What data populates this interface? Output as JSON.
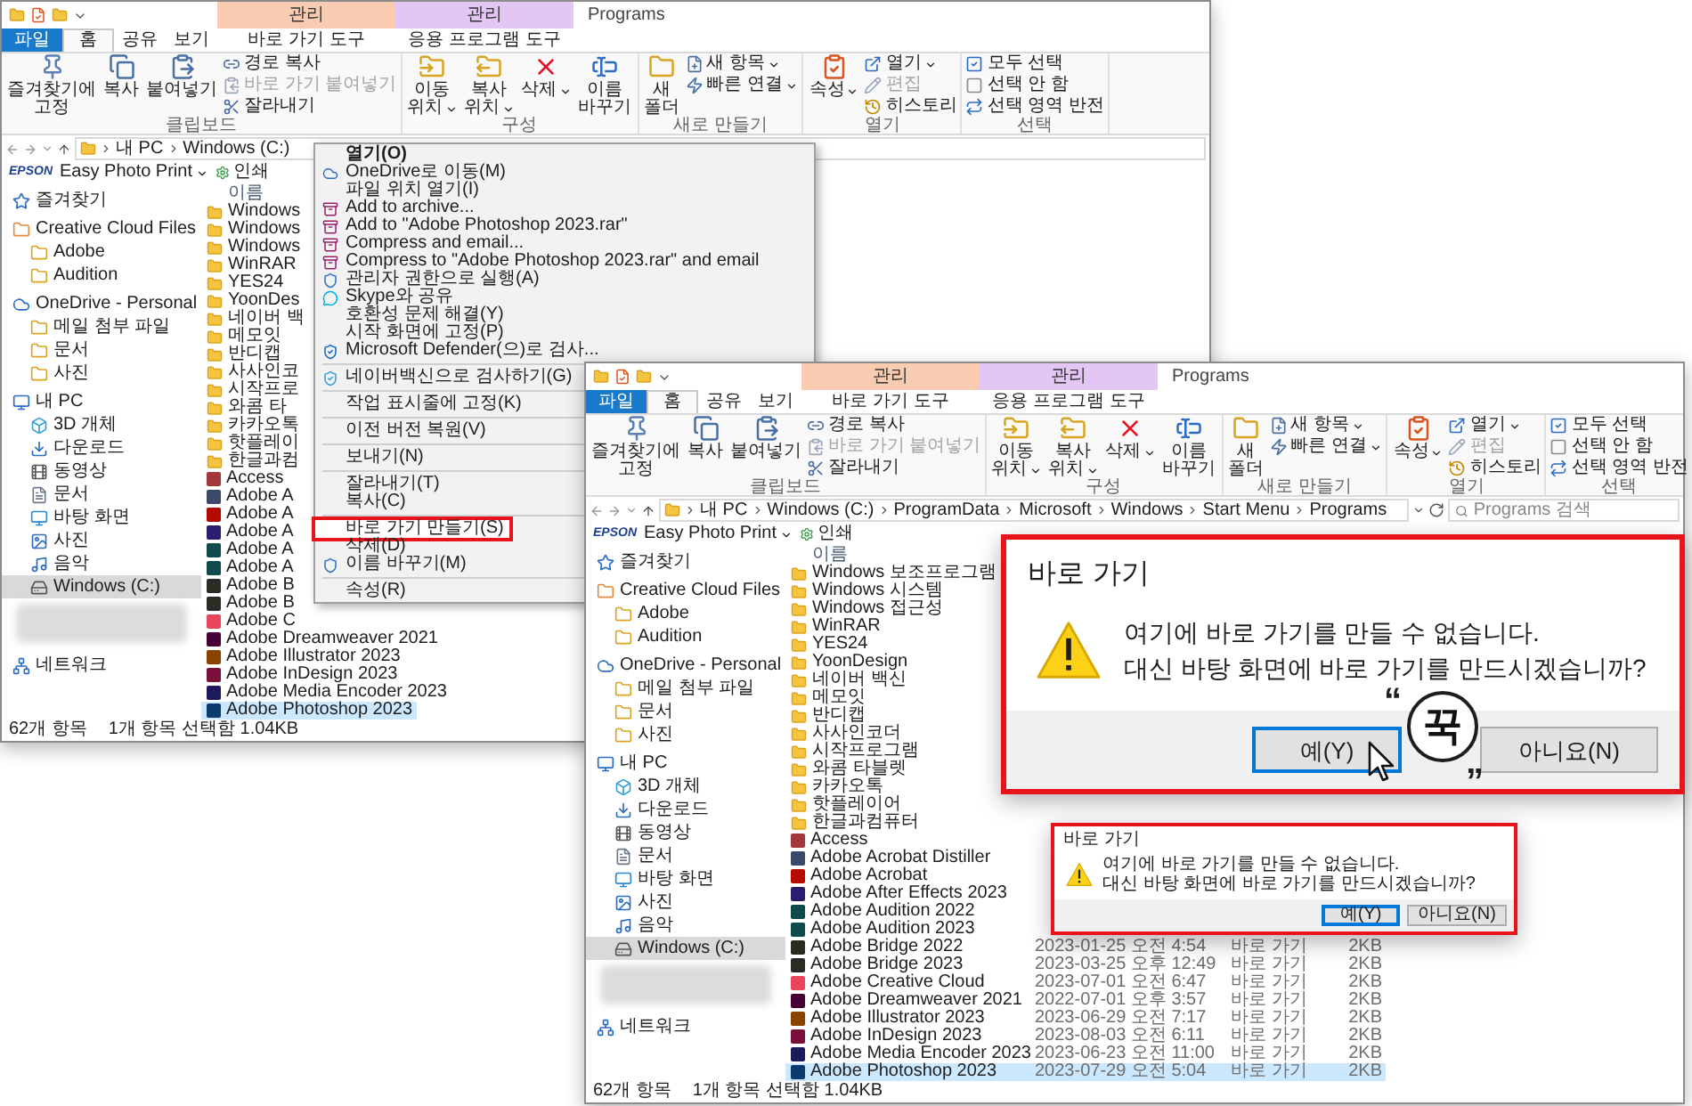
{
  "window_back": {
    "context_headers": [
      {
        "label": "관리",
        "color": "#f9cbb0"
      },
      {
        "label": "관리",
        "color": "#e3c6f4"
      }
    ],
    "title": "Programs",
    "tabs": [
      {
        "label": "파일",
        "kind": "file",
        "selected": false
      },
      {
        "label": "홈",
        "kind": "plain",
        "selected": true
      },
      {
        "label": "공유",
        "kind": "plain",
        "selected": false
      },
      {
        "label": "보기",
        "kind": "plain",
        "selected": false
      },
      {
        "label": "바로 가기 도구",
        "kind": "context",
        "selected": false
      },
      {
        "label": "응용 프로그램 도구",
        "kind": "context",
        "selected": false
      }
    ],
    "ribbon": [
      {
        "label": "클립보드",
        "items": [
          {
            "kind": "large",
            "lines": [
              "즐겨찾기에",
              "고정"
            ],
            "dropdown": false
          },
          {
            "kind": "large",
            "lines": [
              "복사"
            ],
            "dropdown": false
          },
          {
            "kind": "large",
            "lines": [
              "붙여넣기"
            ],
            "dropdown": false
          },
          {
            "kind": "stack",
            "items": [
              {
                "label": "경로 복사",
                "disabled": false,
                "dropdown": false
              },
              {
                "label": "바로 가기 붙여넣기",
                "disabled": true,
                "dropdown": false
              },
              {
                "label": "잘라내기",
                "disabled": false,
                "dropdown": false
              }
            ]
          }
        ]
      },
      {
        "label": "구성",
        "items": [
          {
            "kind": "large",
            "lines": [
              "이동",
              "위치"
            ],
            "dropdown": true
          },
          {
            "kind": "large",
            "lines": [
              "복사",
              "위치"
            ],
            "dropdown": true
          },
          {
            "kind": "large",
            "lines": [
              "삭제"
            ],
            "dropdown": true
          },
          {
            "kind": "large",
            "lines": [
              "이름",
              "바꾸기"
            ],
            "dropdown": false
          }
        ]
      },
      {
        "label": "새로 만들기",
        "items": [
          {
            "kind": "large",
            "lines": [
              "새",
              "폴더"
            ],
            "dropdown": false
          },
          {
            "kind": "stack",
            "items": [
              {
                "label": "새 항목",
                "disabled": false,
                "dropdown": true
              },
              {
                "label": "빠른 연결",
                "disabled": false,
                "dropdown": true
              }
            ]
          }
        ]
      },
      {
        "label": "열기",
        "items": [
          {
            "kind": "large",
            "lines": [
              "속성"
            ],
            "dropdown": true
          },
          {
            "kind": "stack",
            "items": [
              {
                "label": "열기",
                "disabled": false,
                "dropdown": true
              },
              {
                "label": "편집",
                "disabled": true,
                "dropdown": false
              },
              {
                "label": "히스토리",
                "disabled": false,
                "dropdown": false
              }
            ]
          }
        ]
      },
      {
        "label": "선택",
        "items": [
          {
            "kind": "stack",
            "items": [
              {
                "label": "모두 선택",
                "disabled": false,
                "dropdown": false
              },
              {
                "label": "선택 안 함",
                "disabled": false,
                "dropdown": false
              },
              {
                "label": "선택 영역 반전",
                "disabled": false,
                "dropdown": false
              }
            ]
          }
        ]
      }
    ],
    "address": {
      "crumbs": [
        "내 PC",
        "Windows (C:)"
      ]
    },
    "bookmarks": {
      "brand": "EPSON",
      "items": [
        {
          "label": "Easy Photo Print",
          "kind": "dropdown"
        },
        {
          "label": "인쇄",
          "kind": "action"
        }
      ]
    },
    "nav": [
      {
        "label": "즐겨찾기",
        "kind": "item",
        "selected": false
      },
      {
        "label": "Creative Cloud Files",
        "kind": "item",
        "selected": false,
        "children": [
          {
            "label": "Adobe",
            "kind": "item",
            "selected": false
          },
          {
            "label": "Audition",
            "kind": "item",
            "selected": false
          }
        ]
      },
      {
        "label": "OneDrive - Personal",
        "kind": "item",
        "selected": false,
        "children": [
          {
            "label": "메일 첨부 파일",
            "kind": "item",
            "selected": false
          },
          {
            "label": "문서",
            "kind": "item",
            "selected": false
          },
          {
            "label": "사진",
            "kind": "item",
            "selected": false
          }
        ]
      },
      {
        "label": "내 PC",
        "kind": "item",
        "selected": false,
        "children": [
          {
            "label": "3D 개체",
            "kind": "item",
            "selected": false
          },
          {
            "label": "다운로드",
            "kind": "item",
            "selected": false
          },
          {
            "label": "동영상",
            "kind": "item",
            "selected": false
          },
          {
            "label": "문서",
            "kind": "item",
            "selected": false
          },
          {
            "label": "바탕 화면",
            "kind": "item",
            "selected": false
          },
          {
            "label": "사진",
            "kind": "item",
            "selected": false
          },
          {
            "label": "음악",
            "kind": "item",
            "selected": false
          },
          {
            "label": "Windows (C:)",
            "kind": "item",
            "selected": true
          }
        ]
      },
      {
        "kind": "redacted"
      },
      {
        "label": "네트워크",
        "kind": "item",
        "selected": false
      }
    ],
    "columns": [
      "이름"
    ],
    "rows": [
      {
        "name": "Windows",
        "kind": "folder",
        "selected": false
      },
      {
        "name": "Windows",
        "kind": "folder",
        "selected": false
      },
      {
        "name": "Windows",
        "kind": "folder",
        "selected": false
      },
      {
        "name": "WinRAR",
        "kind": "folder",
        "selected": false
      },
      {
        "name": "YES24",
        "kind": "folder",
        "selected": false
      },
      {
        "name": "YoonDes",
        "kind": "folder",
        "selected": false
      },
      {
        "name": "네이버 백",
        "kind": "folder",
        "selected": false
      },
      {
        "name": "메모잇",
        "kind": "folder",
        "selected": false
      },
      {
        "name": "반디캡",
        "kind": "folder",
        "selected": false
      },
      {
        "name": "사사인코",
        "kind": "folder",
        "selected": false
      },
      {
        "name": "시작프로",
        "kind": "folder",
        "selected": false
      },
      {
        "name": "와콤 타",
        "kind": "folder",
        "selected": false
      },
      {
        "name": "카카오톡",
        "kind": "folder",
        "selected": false
      },
      {
        "name": "핫플레이",
        "kind": "folder",
        "selected": false
      },
      {
        "name": "한글과컴",
        "kind": "folder",
        "selected": false
      },
      {
        "name": "Access",
        "kind": "app",
        "color": "#a4373a",
        "selected": false
      },
      {
        "name": "Adobe A",
        "kind": "app",
        "color": "#3b4a6b",
        "selected": false
      },
      {
        "name": "Adobe A",
        "kind": "app",
        "color": "#b30b00",
        "selected": false
      },
      {
        "name": "Adobe A",
        "kind": "app",
        "color": "#2c1c6d",
        "selected": false
      },
      {
        "name": "Adobe A",
        "kind": "app",
        "color": "#0f4a4c",
        "selected": false
      },
      {
        "name": "Adobe A",
        "kind": "app",
        "color": "#0f4a4c",
        "selected": false
      },
      {
        "name": "Adobe B",
        "kind": "app",
        "color": "#2c2a24",
        "selected": false
      },
      {
        "name": "Adobe B",
        "kind": "app",
        "color": "#2c2a24",
        "selected": false
      },
      {
        "name": "Adobe C",
        "kind": "app",
        "color": "#e8465b",
        "selected": false
      },
      {
        "name": "Adobe Dreamweaver 2021",
        "kind": "app",
        "color": "#470137",
        "selected": false
      },
      {
        "name": "Adobe Illustrator 2023",
        "kind": "app",
        "color": "#8a4200",
        "selected": false
      },
      {
        "name": "Adobe InDesign 2023",
        "kind": "app",
        "color": "#7a0f3a",
        "selected": false
      },
      {
        "name": "Adobe Media Encoder 2023",
        "kind": "app",
        "color": "#1f1a5c",
        "selected": false
      },
      {
        "name": "Adobe Photoshop 2023",
        "kind": "app",
        "color": "#0b3a6e",
        "selected": true
      }
    ],
    "status": [
      "62개 항목",
      "1개 항목 선택함 1.04KB"
    ]
  },
  "context_menu": {
    "items": [
      {
        "kind": "item",
        "label": "열기(O)",
        "bold": true,
        "highlighted": false
      },
      {
        "kind": "item",
        "label": "OneDrive로 이동(M)",
        "bold": false,
        "highlighted": false
      },
      {
        "kind": "item",
        "label": "파일 위치 열기(I)",
        "bold": false,
        "highlighted": false
      },
      {
        "kind": "item",
        "label": "Add to archive...",
        "bold": false,
        "highlighted": false
      },
      {
        "kind": "item",
        "label": "Add to \"Adobe Photoshop 2023.rar\"",
        "bold": false,
        "highlighted": false
      },
      {
        "kind": "item",
        "label": "Compress and email...",
        "bold": false,
        "highlighted": false
      },
      {
        "kind": "item",
        "label": "Compress to \"Adobe Photoshop 2023.rar\" and email",
        "bold": false,
        "highlighted": false
      },
      {
        "kind": "item",
        "label": "관리자 권한으로 실행(A)",
        "bold": false,
        "highlighted": false
      },
      {
        "kind": "item",
        "label": "Skype와 공유",
        "bold": false,
        "highlighted": false
      },
      {
        "kind": "item",
        "label": "호환성 문제 해결(Y)",
        "bold": false,
        "highlighted": false
      },
      {
        "kind": "item",
        "label": "시작 화면에 고정(P)",
        "bold": false,
        "highlighted": false
      },
      {
        "kind": "item",
        "label": "Microsoft Defender(으)로 검사...",
        "bold": false,
        "highlighted": false
      },
      {
        "kind": "separator"
      },
      {
        "kind": "item",
        "label": "네이버백신으로 검사하기(G)",
        "bold": false,
        "highlighted": false
      },
      {
        "kind": "separator"
      },
      {
        "kind": "item",
        "label": "작업 표시줄에 고정(K)",
        "bold": false,
        "highlighted": false
      },
      {
        "kind": "separator"
      },
      {
        "kind": "item",
        "label": "이전 버전 복원(V)",
        "bold": false,
        "highlighted": false
      },
      {
        "kind": "separator"
      },
      {
        "kind": "item",
        "label": "보내기(N)",
        "bold": false,
        "highlighted": false
      },
      {
        "kind": "separator"
      },
      {
        "kind": "item",
        "label": "잘라내기(T)",
        "bold": false,
        "highlighted": false
      },
      {
        "kind": "item",
        "label": "복사(C)",
        "bold": false,
        "highlighted": false
      },
      {
        "kind": "separator"
      },
      {
        "kind": "item",
        "label": "바로 가기 만들기(S)",
        "bold": false,
        "highlighted": true
      },
      {
        "kind": "item",
        "label": "삭제(D)",
        "bold": false,
        "highlighted": false
      },
      {
        "kind": "item",
        "label": "이름 바꾸기(M)",
        "bold": false,
        "highlighted": false
      },
      {
        "kind": "separator"
      },
      {
        "kind": "item",
        "label": "속성(R)",
        "bold": false,
        "highlighted": false
      }
    ]
  },
  "window_front": {
    "context_headers": [
      {
        "label": "관리",
        "color": "#f9cbb0"
      },
      {
        "label": "관리",
        "color": "#e3c6f4"
      }
    ],
    "title": "Programs",
    "tabs": [
      {
        "label": "파일",
        "kind": "file",
        "selected": false
      },
      {
        "label": "홈",
        "kind": "plain",
        "selected": true
      },
      {
        "label": "공유",
        "kind": "plain",
        "selected": false
      },
      {
        "label": "보기",
        "kind": "plain",
        "selected": false
      },
      {
        "label": "바로 가기 도구",
        "kind": "context",
        "selected": false
      },
      {
        "label": "응용 프로그램 도구",
        "kind": "context",
        "selected": false
      }
    ],
    "ribbon": [
      {
        "label": "클립보드",
        "items": [
          {
            "kind": "large",
            "lines": [
              "즐겨찾기에",
              "고정"
            ],
            "dropdown": false
          },
          {
            "kind": "large",
            "lines": [
              "복사"
            ],
            "dropdown": false
          },
          {
            "kind": "large",
            "lines": [
              "붙여넣기"
            ],
            "dropdown": false
          },
          {
            "kind": "stack",
            "items": [
              {
                "label": "경로 복사",
                "disabled": false,
                "dropdown": false
              },
              {
                "label": "바로 가기 붙여넣기",
                "disabled": true,
                "dropdown": false
              },
              {
                "label": "잘라내기",
                "disabled": false,
                "dropdown": false
              }
            ]
          }
        ]
      },
      {
        "label": "구성",
        "items": [
          {
            "kind": "large",
            "lines": [
              "이동",
              "위치"
            ],
            "dropdown": true
          },
          {
            "kind": "large",
            "lines": [
              "복사",
              "위치"
            ],
            "dropdown": true
          },
          {
            "kind": "large",
            "lines": [
              "삭제"
            ],
            "dropdown": true
          },
          {
            "kind": "large",
            "lines": [
              "이름",
              "바꾸기"
            ],
            "dropdown": false
          }
        ]
      },
      {
        "label": "새로 만들기",
        "items": [
          {
            "kind": "large",
            "lines": [
              "새",
              "폴더"
            ],
            "dropdown": false
          },
          {
            "kind": "stack",
            "items": [
              {
                "label": "새 항목",
                "disabled": false,
                "dropdown": true
              },
              {
                "label": "빠른 연결",
                "disabled": false,
                "dropdown": true
              }
            ]
          }
        ]
      },
      {
        "label": "열기",
        "items": [
          {
            "kind": "large",
            "lines": [
              "속성"
            ],
            "dropdown": true
          },
          {
            "kind": "stack",
            "items": [
              {
                "label": "열기",
                "disabled": false,
                "dropdown": true
              },
              {
                "label": "편집",
                "disabled": true,
                "dropdown": false
              },
              {
                "label": "히스토리",
                "disabled": false,
                "dropdown": false
              }
            ]
          }
        ]
      },
      {
        "label": "선택",
        "items": [
          {
            "kind": "stack",
            "items": [
              {
                "label": "모두 선택",
                "disabled": false,
                "dropdown": false
              },
              {
                "label": "선택 안 함",
                "disabled": false,
                "dropdown": false
              },
              {
                "label": "선택 영역 반전",
                "disabled": false,
                "dropdown": false
              }
            ]
          }
        ]
      }
    ],
    "address": {
      "crumbs": [
        "내 PC",
        "Windows (C:)",
        "ProgramData",
        "Microsoft",
        "Windows",
        "Start Menu",
        "Programs"
      ],
      "placeholder": "Programs 검색"
    },
    "bookmarks": {
      "brand": "EPSON",
      "items": [
        {
          "label": "Easy Photo Print",
          "kind": "dropdown"
        },
        {
          "label": "인쇄",
          "kind": "action"
        }
      ]
    },
    "nav": [
      {
        "label": "즐겨찾기",
        "kind": "item",
        "selected": false
      },
      {
        "label": "Creative Cloud Files",
        "kind": "item",
        "selected": false,
        "children": [
          {
            "label": "Adobe",
            "kind": "item",
            "selected": false
          },
          {
            "label": "Audition",
            "kind": "item",
            "selected": false
          }
        ]
      },
      {
        "label": "OneDrive - Personal",
        "kind": "item",
        "selected": false,
        "children": [
          {
            "label": "메일 첨부 파일",
            "kind": "item",
            "selected": false
          },
          {
            "label": "문서",
            "kind": "item",
            "selected": false
          },
          {
            "label": "사진",
            "kind": "item",
            "selected": false
          }
        ]
      },
      {
        "label": "내 PC",
        "kind": "item",
        "selected": false,
        "children": [
          {
            "label": "3D 개체",
            "kind": "item",
            "selected": false
          },
          {
            "label": "다운로드",
            "kind": "item",
            "selected": false
          },
          {
            "label": "동영상",
            "kind": "item",
            "selected": false
          },
          {
            "label": "문서",
            "kind": "item",
            "selected": false
          },
          {
            "label": "바탕 화면",
            "kind": "item",
            "selected": false
          },
          {
            "label": "사진",
            "kind": "item",
            "selected": false
          },
          {
            "label": "음악",
            "kind": "item",
            "selected": false
          },
          {
            "label": "Windows (C:)",
            "kind": "item",
            "selected": true
          }
        ]
      },
      {
        "kind": "redacted"
      },
      {
        "label": "네트워크",
        "kind": "item",
        "selected": false
      }
    ],
    "columns": [
      "이름"
    ],
    "rows": [
      {
        "name": "Windows 보조프로그램",
        "kind": "folder",
        "selected": false
      },
      {
        "name": "Windows 시스템",
        "kind": "folder",
        "selected": false
      },
      {
        "name": "Windows 접근성",
        "kind": "folder",
        "selected": false
      },
      {
        "name": "WinRAR",
        "kind": "folder",
        "selected": false
      },
      {
        "name": "YES24",
        "kind": "folder",
        "selected": false
      },
      {
        "name": "YoonDesign",
        "kind": "folder",
        "selected": false
      },
      {
        "name": "네이버 백신",
        "kind": "folder",
        "selected": false
      },
      {
        "name": "메모잇",
        "kind": "folder",
        "selected": false
      },
      {
        "name": "반디캡",
        "kind": "folder",
        "selected": false
      },
      {
        "name": "사사인코더",
        "kind": "folder",
        "selected": false
      },
      {
        "name": "시작프로그램",
        "kind": "folder",
        "selected": false
      },
      {
        "name": "와콤 타블렛",
        "kind": "folder",
        "selected": false
      },
      {
        "name": "카카오톡",
        "kind": "folder",
        "selected": false
      },
      {
        "name": "핫플레이어",
        "kind": "folder",
        "selected": false
      },
      {
        "name": "한글과컴퓨터",
        "kind": "folder",
        "selected": false
      },
      {
        "name": "Access",
        "kind": "app",
        "color": "#a4373a",
        "selected": false
      },
      {
        "name": "Adobe Acrobat Distiller",
        "kind": "app",
        "color": "#3b4a6b",
        "selected": false
      },
      {
        "name": "Adobe Acrobat",
        "kind": "app",
        "color": "#b30b00",
        "selected": false
      },
      {
        "name": "Adobe After Effects 2023",
        "kind": "app",
        "color": "#2c1c6d",
        "selected": false
      },
      {
        "name": "Adobe Audition 2022",
        "kind": "app",
        "color": "#0f4a4c",
        "selected": false
      },
      {
        "name": "Adobe Audition 2023",
        "kind": "app",
        "color": "#0f4a4c",
        "selected": false
      },
      {
        "name": "Adobe Bridge 2022",
        "kind": "app",
        "color": "#2c2a24",
        "selected": false,
        "date": "2023-01-25 오전 4:54",
        "type": "바로 가기",
        "size": "2KB"
      },
      {
        "name": "Adobe Bridge 2023",
        "kind": "app",
        "color": "#2c2a24",
        "selected": false,
        "date": "2023-03-25 오후 12:49",
        "type": "바로 가기",
        "size": "2KB"
      },
      {
        "name": "Adobe Creative Cloud",
        "kind": "app",
        "color": "#e8465b",
        "selected": false,
        "date": "2023-07-01 오전 6:47",
        "type": "바로 가기",
        "size": "2KB"
      },
      {
        "name": "Adobe Dreamweaver 2021",
        "kind": "app",
        "color": "#470137",
        "selected": false,
        "date": "2022-07-01 오후 3:57",
        "type": "바로 가기",
        "size": "2KB"
      },
      {
        "name": "Adobe Illustrator 2023",
        "kind": "app",
        "color": "#8a4200",
        "selected": false,
        "date": "2023-06-29 오전 7:17",
        "type": "바로 가기",
        "size": "2KB"
      },
      {
        "name": "Adobe InDesign 2023",
        "kind": "app",
        "color": "#7a0f3a",
        "selected": false,
        "date": "2023-08-03 오전 6:11",
        "type": "바로 가기",
        "size": "2KB"
      },
      {
        "name": "Adobe Media Encoder 2023",
        "kind": "app",
        "color": "#1f1a5c",
        "selected": false,
        "date": "2023-06-23 오전 11:00",
        "type": "바로 가기",
        "size": "2KB"
      },
      {
        "name": "Adobe Photoshop 2023",
        "kind": "app",
        "color": "#0b3a6e",
        "selected": true,
        "date": "2023-07-29 오전 5:04",
        "type": "바로 가기",
        "size": "2KB"
      }
    ],
    "status": [
      "62개 항목",
      "1개 항목 선택함 1.04KB"
    ]
  },
  "small_dialog": {
    "title": "바로 가기",
    "lines": [
      "여기에 바로 가기를 만들 수 없습니다.",
      "대신 바탕 화면에 바로 가기를 만드시겠습니까?"
    ],
    "highlighted": true,
    "buttons": [
      {
        "label": "예(Y)",
        "default": true
      },
      {
        "label": "아니요(N)",
        "default": false
      }
    ]
  },
  "dialog": {
    "title": "바로 가기",
    "lines": [
      "여기에 바로 가기를 만들 수 없습니다.",
      "대신 바탕 화면에 바로 가기를 만드시겠습니까?"
    ],
    "highlighted": true,
    "buttons": [
      {
        "label": "예(Y)",
        "default": true
      },
      {
        "label": "아니요(N)",
        "default": false
      }
    ]
  },
  "callout": {
    "text": "꾹",
    "quotes": [
      "“",
      "„"
    ]
  }
}
